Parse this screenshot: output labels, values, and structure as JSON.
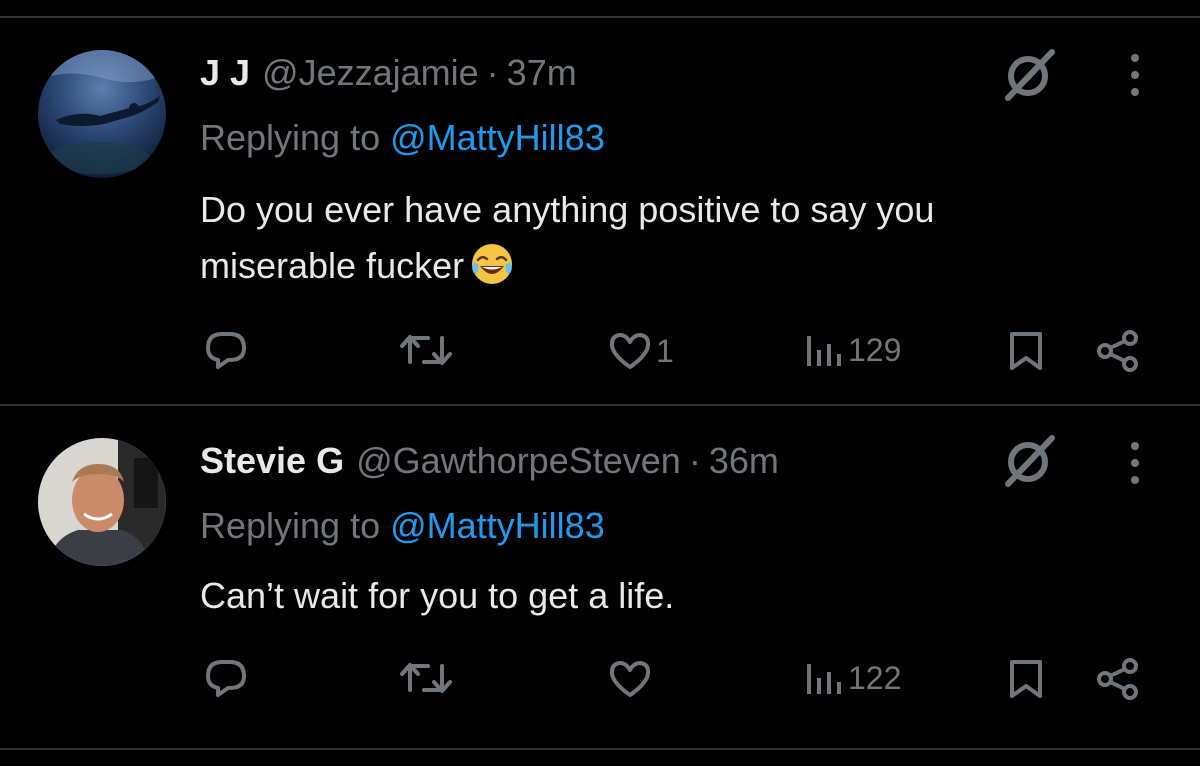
{
  "tweets": [
    {
      "display_name": "J J",
      "handle": "@Jezzajamie",
      "separator": "·",
      "time": "37m",
      "replying_prefix": "Replying to",
      "replying_to": "@MattyHill83",
      "text_line1": "Do you ever have anything positive to say you",
      "text_line2": "miserable fucker",
      "emoji": "face-with-tears-of-joy",
      "likes": "1",
      "views": "129",
      "avatar_icon": "swimmer-underwater-photo"
    },
    {
      "display_name": "Stevie G",
      "handle": "@GawthorpeSteven",
      "separator": "·",
      "time": "36m",
      "replying_prefix": "Replying to",
      "replying_to": "@MattyHill83",
      "text_line1": "Can’t wait for you to get a life.",
      "likes": "",
      "views": "122",
      "avatar_icon": "man-selfie-photo"
    }
  ],
  "icons": {
    "reply": "reply-icon",
    "retweet": "retweet-icon",
    "like": "heart-icon",
    "views": "views-icon",
    "bookmark": "bookmark-icon",
    "share": "share-icon",
    "grok": "grok-icon",
    "more": "more-icon"
  },
  "colors": {
    "background": "#000000",
    "text_primary": "#e7e9ea",
    "text_secondary": "#71767b",
    "accent": "#1d9bf0",
    "divider": "#2f3336"
  }
}
